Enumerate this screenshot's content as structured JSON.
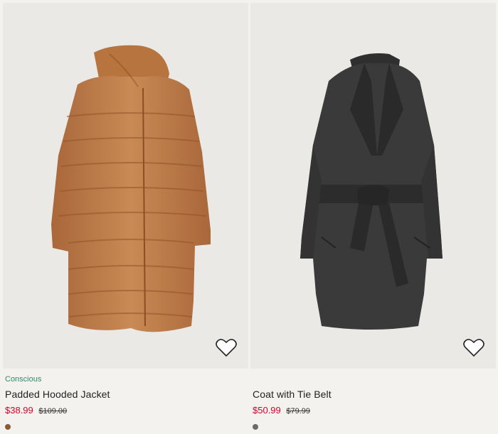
{
  "products": [
    {
      "tag": "Conscious",
      "title": "Padded Hooded Jacket",
      "price_sale": "$38.99",
      "price_old": "$109.00",
      "swatch_color": "#8a5a34",
      "image_icon": "padded-jacket-image"
    },
    {
      "tag": "",
      "title": "Coat with Tie Belt",
      "price_sale": "$50.99",
      "price_old": "$79.99",
      "swatch_color": "#6b6b6b",
      "image_icon": "coat-image"
    }
  ],
  "colors": {
    "sale": "#d1042d",
    "conscious": "#2e8b70",
    "image_bg": "#ebe9e6"
  }
}
